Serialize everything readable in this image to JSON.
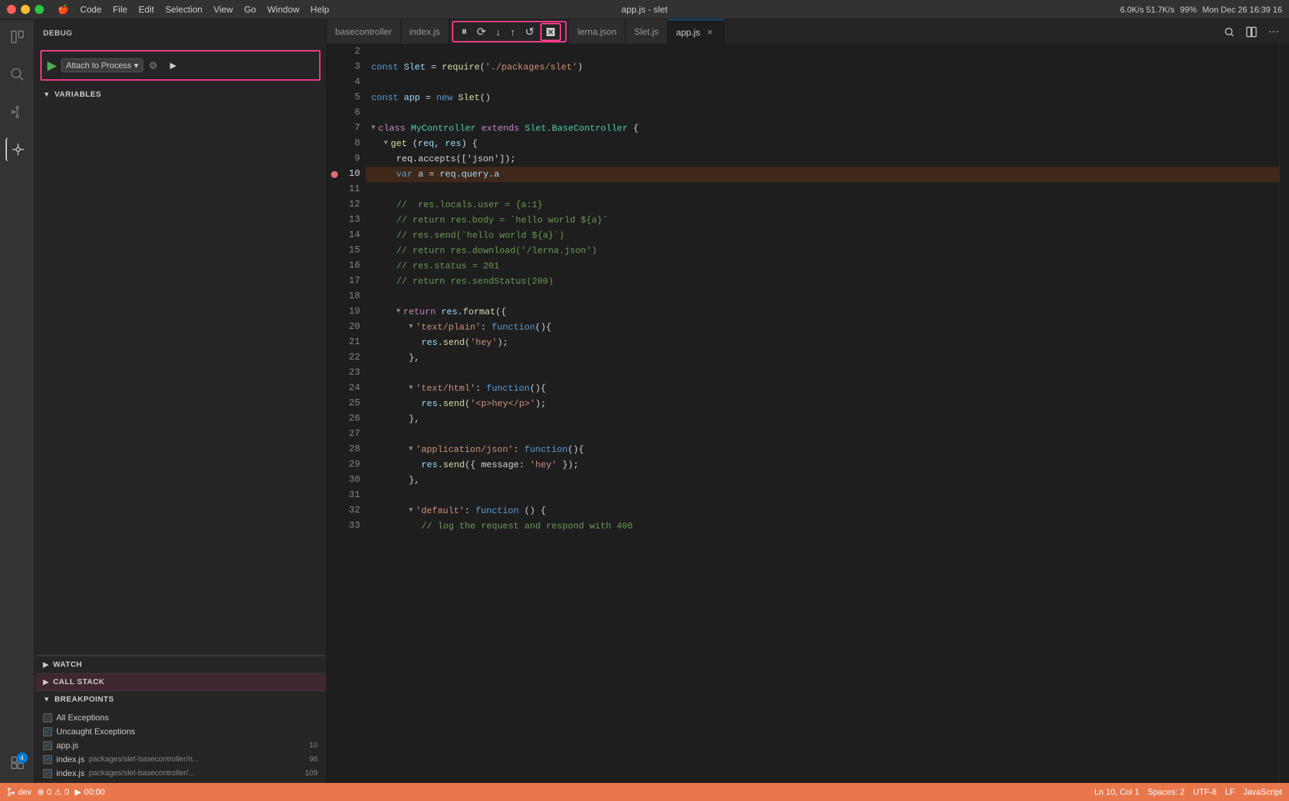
{
  "titlebar": {
    "app_name": "Code",
    "file_title": "app.js - slet",
    "menu_items": [
      "File",
      "Edit",
      "Selection",
      "View",
      "Go",
      "Window",
      "Help"
    ],
    "system": {
      "time": "Mon Dec 26  16:39 16",
      "battery": "99%",
      "network": "6.0K/s 51.7K/s"
    }
  },
  "activity_bar": {
    "icons": [
      {
        "name": "explorer-icon",
        "symbol": "⎘",
        "active": false
      },
      {
        "name": "search-icon",
        "symbol": "🔍",
        "active": false
      },
      {
        "name": "source-control-icon",
        "symbol": "⑂",
        "active": false
      },
      {
        "name": "debug-icon",
        "symbol": "⬡",
        "active": true
      },
      {
        "name": "extensions-icon",
        "symbol": "⊞",
        "active": false,
        "badge": "4"
      }
    ]
  },
  "sidebar": {
    "header": "DEBUG",
    "debug_config": "Attach to Process",
    "sections": {
      "variables": {
        "label": "VARIABLES",
        "expanded": true
      },
      "watch": {
        "label": "WATCH",
        "expanded": false
      },
      "callstack": {
        "label": "CALL STACK",
        "expanded": false
      },
      "breakpoints": {
        "label": "BREAKPOINTS",
        "expanded": true,
        "items": [
          {
            "label": "All Exceptions",
            "checked": false
          },
          {
            "label": "Uncaught Exceptions",
            "checked": true
          },
          {
            "label": "app.js",
            "checked": true,
            "badge": "10"
          },
          {
            "label": "index.js",
            "detail": "packages/slet-basecontroller/n...",
            "checked": true,
            "badge": "96"
          },
          {
            "label": "index.js",
            "detail": "packages/slet-basecontroller/...",
            "checked": true,
            "badge": "109"
          }
        ]
      }
    }
  },
  "tabs": [
    {
      "label": "basecontroller",
      "active": false,
      "closeable": false
    },
    {
      "label": "index.js",
      "active": false,
      "closeable": false
    },
    {
      "label": "lerna.json",
      "active": false,
      "closeable": false
    },
    {
      "label": "Slet.js",
      "active": false,
      "closeable": false
    },
    {
      "label": "app.js",
      "active": true,
      "closeable": true
    }
  ],
  "debug_controls": [
    {
      "name": "pause-btn",
      "symbol": "⏸",
      "label": "Pause"
    },
    {
      "name": "step-over-btn",
      "symbol": "↺",
      "label": "Step Over"
    },
    {
      "name": "step-into-btn",
      "symbol": "↓",
      "label": "Step Into"
    },
    {
      "name": "step-out-btn",
      "symbol": "↑",
      "label": "Step Out"
    },
    {
      "name": "restart-btn",
      "symbol": "↻",
      "label": "Restart"
    },
    {
      "name": "stop-btn",
      "symbol": "⏹",
      "label": "Stop"
    }
  ],
  "editor": {
    "filename": "app.js",
    "lines": [
      {
        "num": 2,
        "content": ""
      },
      {
        "num": 3,
        "tokens": [
          {
            "t": "kw",
            "v": "const "
          },
          {
            "t": "var",
            "v": "Slet"
          },
          {
            "t": "op",
            "v": " = "
          },
          {
            "t": "fn",
            "v": "require"
          },
          {
            "t": "op",
            "v": "("
          },
          {
            "t": "str",
            "v": "'./packages/slet'"
          },
          {
            "t": "op",
            "v": ")"
          }
        ]
      },
      {
        "num": 4,
        "content": ""
      },
      {
        "num": 5,
        "tokens": [
          {
            "t": "kw",
            "v": "const "
          },
          {
            "t": "var",
            "v": "app"
          },
          {
            "t": "op",
            "v": " = "
          },
          {
            "t": "kw",
            "v": "new "
          },
          {
            "t": "fn",
            "v": "Slet"
          },
          {
            "t": "op",
            "v": "()"
          }
        ]
      },
      {
        "num": 6,
        "content": ""
      },
      {
        "num": 7,
        "fold": true,
        "tokens": [
          {
            "t": "kw2",
            "v": "class "
          },
          {
            "t": "cls",
            "v": "MyController "
          },
          {
            "t": "kw2",
            "v": "extends "
          },
          {
            "t": "cls",
            "v": "Slet.BaseController "
          },
          {
            "t": "op",
            "v": "{"
          }
        ]
      },
      {
        "num": 8,
        "fold": true,
        "indent": 1,
        "tokens": [
          {
            "t": "fn",
            "v": "get "
          },
          {
            "t": "op",
            "v": "("
          },
          {
            "t": "var",
            "v": "req"
          },
          {
            "t": "op",
            "v": ", "
          },
          {
            "t": "var",
            "v": "res"
          },
          {
            "t": "op",
            "v": ") {"
          }
        ]
      },
      {
        "num": 9,
        "indent": 2,
        "content": "req.accepts(['json']);"
      },
      {
        "num": 10,
        "indent": 2,
        "breakpoint": true,
        "tokens": [
          {
            "t": "kw",
            "v": "var "
          },
          {
            "t": "var",
            "v": "a"
          },
          {
            "t": "op",
            "v": " = "
          },
          {
            "t": "var",
            "v": "req.query.a"
          }
        ]
      },
      {
        "num": 11,
        "content": ""
      },
      {
        "num": 12,
        "indent": 2,
        "tokens": [
          {
            "t": "cmt",
            "v": "//  res.locals.user = {a:1}"
          }
        ]
      },
      {
        "num": 13,
        "indent": 2,
        "tokens": [
          {
            "t": "cmt",
            "v": "// return res.body = `hello world ${a}`"
          }
        ]
      },
      {
        "num": 14,
        "indent": 2,
        "tokens": [
          {
            "t": "cmt",
            "v": "// res.send(`hello world ${a}`)"
          }
        ]
      },
      {
        "num": 15,
        "indent": 2,
        "tokens": [
          {
            "t": "cmt",
            "v": "// return res.download('/lerna.json')"
          }
        ]
      },
      {
        "num": 16,
        "indent": 2,
        "tokens": [
          {
            "t": "cmt",
            "v": "// res.status = 201"
          }
        ]
      },
      {
        "num": 17,
        "indent": 2,
        "tokens": [
          {
            "t": "cmt",
            "v": "// return res.sendStatus(200)"
          }
        ]
      },
      {
        "num": 18,
        "content": ""
      },
      {
        "num": 19,
        "fold": true,
        "indent": 2,
        "tokens": [
          {
            "t": "kw2",
            "v": "return "
          },
          {
            "t": "var",
            "v": "res"
          },
          {
            "t": "op",
            "v": "."
          },
          {
            "t": "fn",
            "v": "format"
          },
          {
            "t": "op",
            "v": "({"
          }
        ]
      },
      {
        "num": 20,
        "fold": true,
        "indent": 3,
        "tokens": [
          {
            "t": "str",
            "v": "'text/plain'"
          },
          {
            "t": "op",
            "v": ": "
          },
          {
            "t": "kw",
            "v": "function"
          },
          {
            "t": "op",
            "v": "(){"
          }
        ]
      },
      {
        "num": 21,
        "indent": 4,
        "tokens": [
          {
            "t": "var",
            "v": "res"
          },
          {
            "t": "op",
            "v": "."
          },
          {
            "t": "fn",
            "v": "send"
          },
          {
            "t": "op",
            "v": "("
          },
          {
            "t": "str",
            "v": "'hey'"
          },
          {
            "t": "op",
            "v": ");"
          }
        ]
      },
      {
        "num": 22,
        "indent": 3,
        "content": "},"
      },
      {
        "num": 23,
        "content": ""
      },
      {
        "num": 24,
        "fold": true,
        "indent": 3,
        "tokens": [
          {
            "t": "str",
            "v": "'text/html'"
          },
          {
            "t": "op",
            "v": ": "
          },
          {
            "t": "kw",
            "v": "function"
          },
          {
            "t": "op",
            "v": "(){"
          }
        ]
      },
      {
        "num": 25,
        "indent": 4,
        "tokens": [
          {
            "t": "var",
            "v": "res"
          },
          {
            "t": "op",
            "v": "."
          },
          {
            "t": "fn",
            "v": "send"
          },
          {
            "t": "op",
            "v": "("
          },
          {
            "t": "str",
            "v": "'<p>hey</p>'"
          },
          {
            "t": "op",
            "v": ");"
          }
        ]
      },
      {
        "num": 26,
        "indent": 3,
        "content": "},"
      },
      {
        "num": 27,
        "content": ""
      },
      {
        "num": 28,
        "fold": true,
        "indent": 3,
        "tokens": [
          {
            "t": "str",
            "v": "'application/json'"
          },
          {
            "t": "op",
            "v": ": "
          },
          {
            "t": "kw",
            "v": "function"
          },
          {
            "t": "op",
            "v": "(){"
          }
        ]
      },
      {
        "num": 29,
        "indent": 4,
        "tokens": [
          {
            "t": "var",
            "v": "res"
          },
          {
            "t": "op",
            "v": "."
          },
          {
            "t": "fn",
            "v": "send"
          },
          {
            "t": "op",
            "v": "({ message: "
          },
          {
            "t": "str",
            "v": "'hey'"
          },
          {
            "t": "op",
            "v": " });"
          }
        ]
      },
      {
        "num": 30,
        "indent": 3,
        "content": "},"
      },
      {
        "num": 31,
        "content": ""
      },
      {
        "num": 32,
        "fold": true,
        "indent": 3,
        "tokens": [
          {
            "t": "str",
            "v": "'default'"
          },
          {
            "t": "op",
            "v": ": "
          },
          {
            "t": "kw",
            "v": "function "
          },
          {
            "t": "op",
            "v": "() {"
          }
        ]
      },
      {
        "num": 33,
        "indent": 4,
        "tokens": [
          {
            "t": "cmt",
            "v": "// log the request and respond with 406"
          }
        ]
      }
    ],
    "breakpoint_line": 10
  },
  "status_bar": {
    "git_branch": "dev",
    "errors": "0",
    "warnings": "0",
    "debug_time": "00:00",
    "cursor": "Ln 10, Col 1",
    "spaces": "Spaces: 2",
    "encoding": "UTF-8",
    "line_ending": "LF",
    "language": "JavaScript"
  }
}
